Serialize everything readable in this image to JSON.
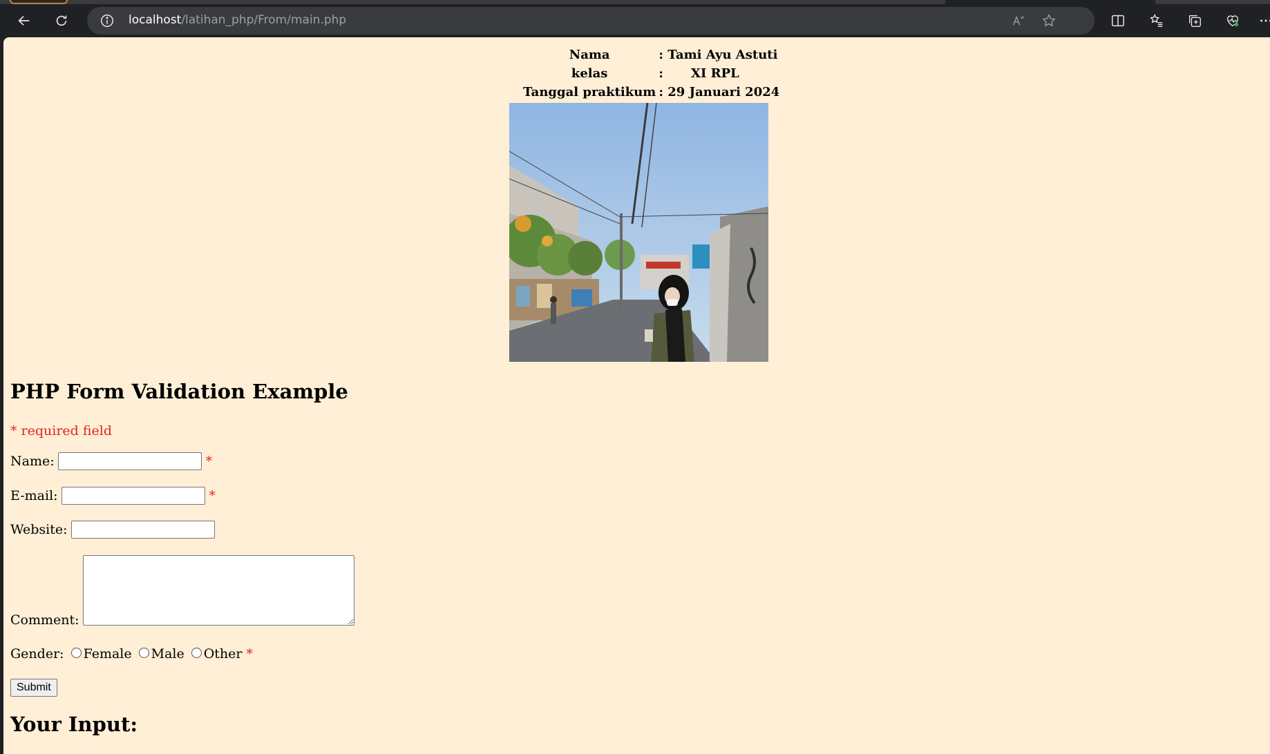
{
  "browser": {
    "url_host": "localhost",
    "url_path": "/latihan_php/From/main.php"
  },
  "identity": {
    "rows": [
      {
        "label": "Nama",
        "colon": ":",
        "value": "Tami Ayu Astuti"
      },
      {
        "label": "kelas",
        "colon": ":",
        "value": "XI RPL"
      },
      {
        "label": "Tanggal praktikum",
        "colon": ":",
        "value": "29 Januari 2024"
      }
    ]
  },
  "form": {
    "title": "PHP Form Validation Example",
    "required_note": "* required field",
    "name_label": "Name:",
    "email_label": "E-mail:",
    "website_label": "Website:",
    "comment_label": "Comment:",
    "gender_label": "Gender:",
    "gender_options": [
      "Female",
      "Male",
      "Other"
    ],
    "required_star": "*",
    "submit_label": "Submit"
  },
  "output": {
    "title": "Your Input:"
  },
  "icons": {
    "back": "back-arrow-icon",
    "refresh": "refresh-icon",
    "info": "info-icon",
    "read_aloud": "read-aloud-icon",
    "favorite": "star-icon",
    "split_screen": "split-screen-icon",
    "favorites": "favorites-list-icon",
    "collections": "collections-icon",
    "health": "browser-essentials-icon",
    "more": "more-icon"
  },
  "colors": {
    "page_background": "#feefd6",
    "required": "#e0251b",
    "chrome": "#202124"
  }
}
